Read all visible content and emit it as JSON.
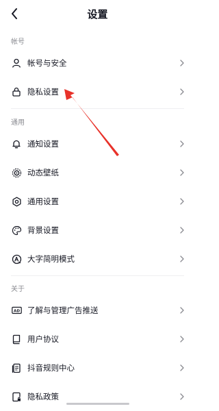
{
  "header": {
    "title": "设置"
  },
  "sections": {
    "account": {
      "label": "帐号",
      "items": [
        {
          "label": "帐号与安全",
          "icon": "user-icon"
        },
        {
          "label": "隐私设置",
          "icon": "lock-icon"
        }
      ]
    },
    "general": {
      "label": "通用",
      "items": [
        {
          "label": "通知设置",
          "icon": "bell-icon"
        },
        {
          "label": "动态壁纸",
          "icon": "wallpaper-icon"
        },
        {
          "label": "通用设置",
          "icon": "gear-icon"
        },
        {
          "label": "背景设置",
          "icon": "palette-icon"
        },
        {
          "label": "大字简明模式",
          "icon": "font-size-icon"
        }
      ]
    },
    "about": {
      "label": "关于",
      "items": [
        {
          "label": "了解与管理广告推送",
          "icon": "ad-icon"
        },
        {
          "label": "用户协议",
          "icon": "book-icon"
        },
        {
          "label": "抖音规则中心",
          "icon": "document-icon"
        },
        {
          "label": "隐私政策",
          "icon": "privacy-policy-icon"
        }
      ]
    }
  },
  "colors": {
    "text": "#161823",
    "secondary": "#8a8b91",
    "annotation_arrow": "#e8322a"
  }
}
